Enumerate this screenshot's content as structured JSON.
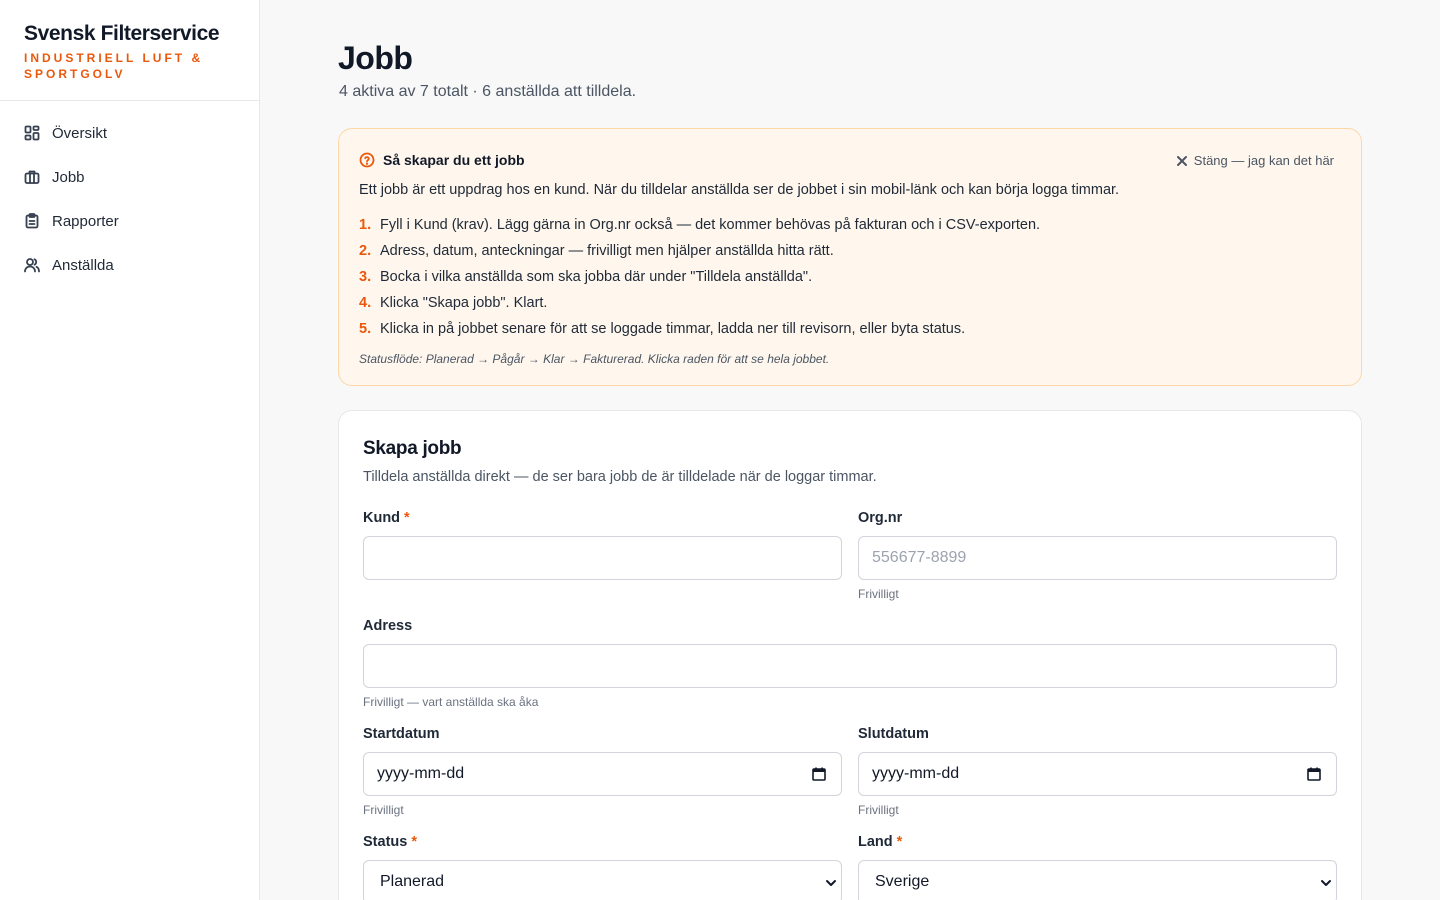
{
  "brand": {
    "name": "Svensk Filterservice",
    "tagline": "INDUSTRIELL LUFT & SPORTGOLV",
    "accent": "#ea580c"
  },
  "nav": {
    "items": [
      {
        "label": "Översikt",
        "icon": "grid-icon"
      },
      {
        "label": "Jobb",
        "icon": "briefcase-icon"
      },
      {
        "label": "Rapporter",
        "icon": "clipboard-icon"
      },
      {
        "label": "Anställda",
        "icon": "users-icon"
      }
    ]
  },
  "page": {
    "title": "Jobb",
    "subtitle": "4 aktiva av 7 totalt · 6 anställda att tilldela."
  },
  "help": {
    "title": "Så skapar du ett jobb",
    "close_label": "Stäng — jag kan det här",
    "intro": "Ett jobb är ett uppdrag hos en kund. När du tilldelar anställda ser de jobbet i sin mobil-länk och kan börja logga timmar.",
    "steps": [
      {
        "num": "1.",
        "text": "Fyll i Kund (krav). Lägg gärna in Org.nr också — det kommer behövas på fakturan och i CSV-exporten."
      },
      {
        "num": "2.",
        "text": "Adress, datum, anteckningar — frivilligt men hjälper anställda hitta rätt."
      },
      {
        "num": "3.",
        "text": "Bocka i vilka anställda som ska jobba där under \"Tilldela anställda\"."
      },
      {
        "num": "4.",
        "text": "Klicka \"Skapa jobb\". Klart."
      },
      {
        "num": "5.",
        "text": "Klicka in på jobbet senare för att se loggade timmar, ladda ner till revisorn, eller byta status."
      }
    ],
    "footer": "Statusflöde: Planerad → Pågår → Klar → Fakturerad. Klicka raden för att se hela jobbet."
  },
  "form": {
    "title": "Skapa jobb",
    "subtitle": "Tilldela anställda direkt — de ser bara jobb de är tilldelade när de loggar timmar.",
    "required_mark": "*",
    "kund": {
      "label": "Kund",
      "value": ""
    },
    "orgnr": {
      "label": "Org.nr",
      "placeholder": "556677-8899",
      "hint": "Frivilligt"
    },
    "adress": {
      "label": "Adress",
      "value": "",
      "hint": "Frivilligt — vart anställda ska åka"
    },
    "startdatum": {
      "label": "Startdatum",
      "value": "yyyy-mm-dd",
      "hint": "Frivilligt"
    },
    "slutdatum": {
      "label": "Slutdatum",
      "value": "yyyy-mm-dd",
      "hint": "Frivilligt"
    },
    "status": {
      "label": "Status",
      "value": "Planerad"
    },
    "land": {
      "label": "Land",
      "value": "Sverige"
    }
  }
}
